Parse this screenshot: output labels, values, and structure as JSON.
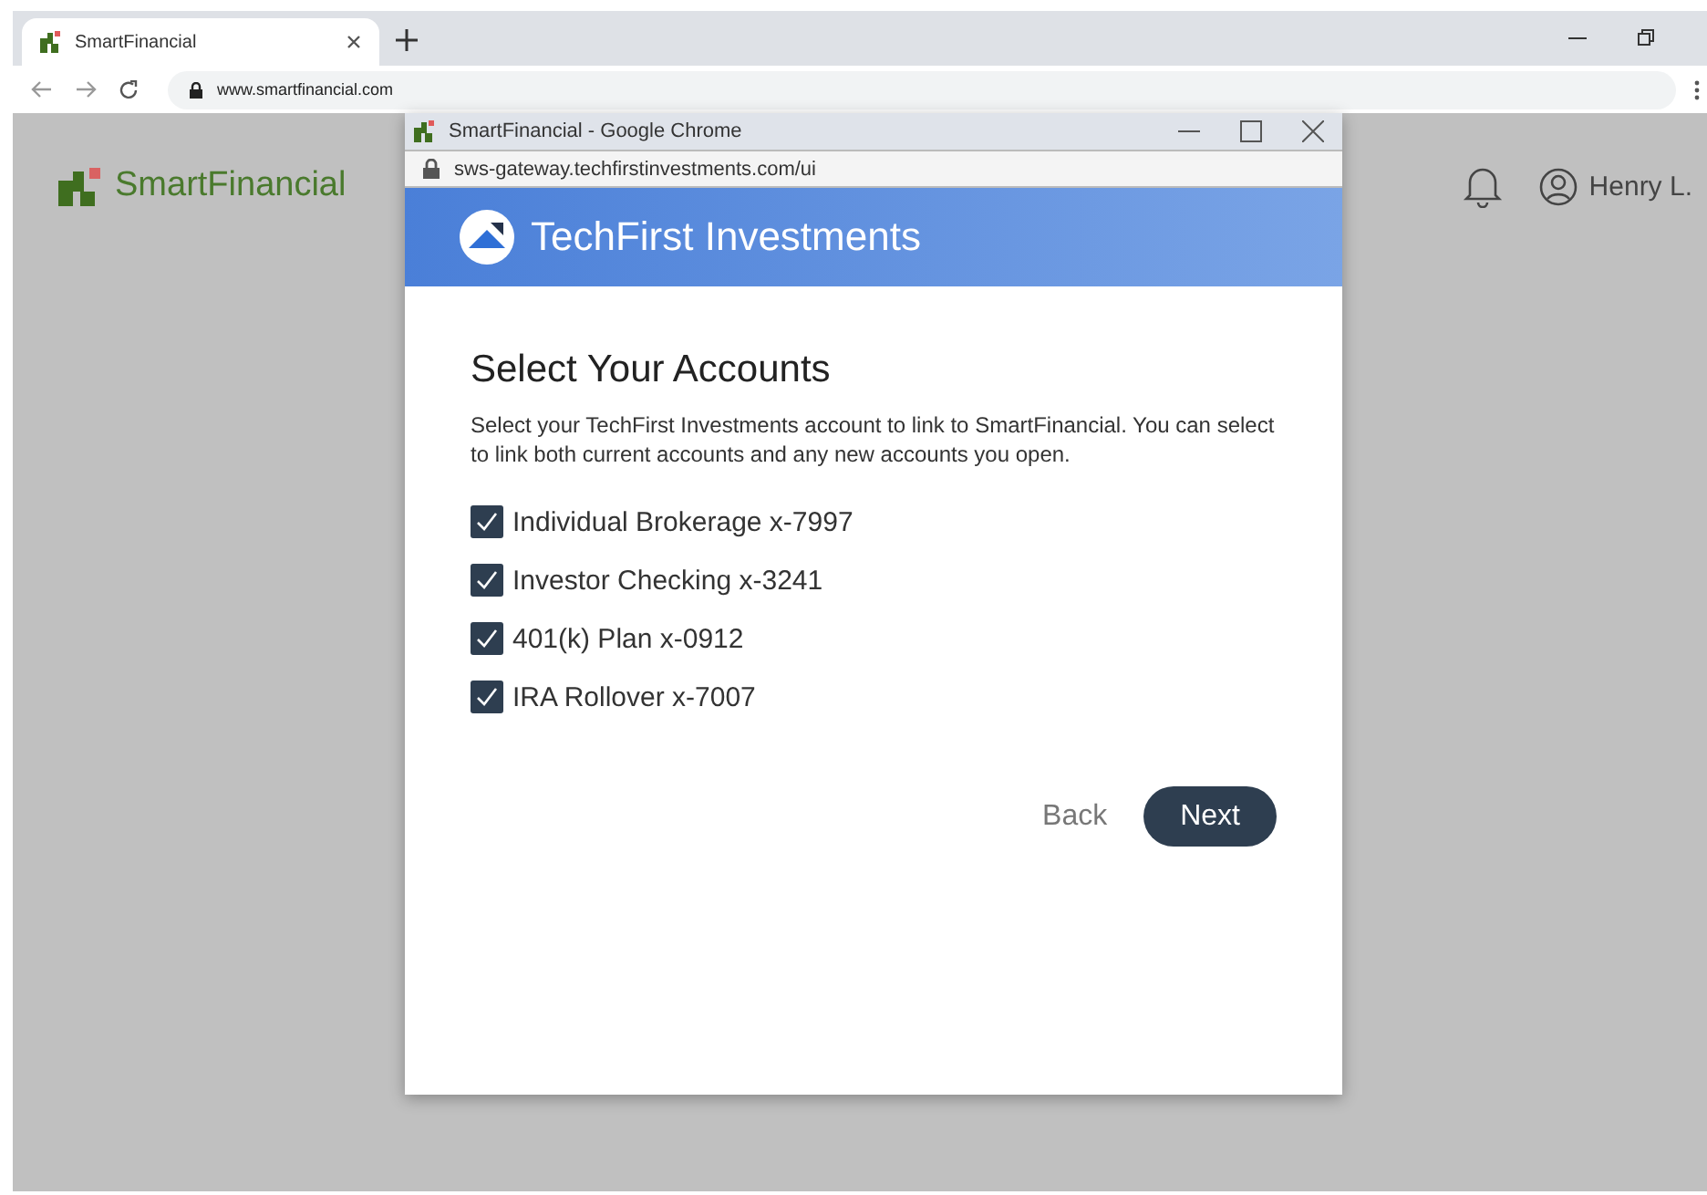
{
  "browser": {
    "tab": {
      "title": "SmartFinancial",
      "selected": true
    },
    "address": "www.smartfinancial.com"
  },
  "site": {
    "logo_text": "SmartFinancial",
    "user": "Henry L."
  },
  "popup": {
    "title": "SmartFinancial - Google Chrome",
    "address": "sws-gateway.techfirstinvestments.com/ui",
    "brand": "TechFirst Investments",
    "heading": "Select Your Accounts",
    "description": "Select your TechFirst Investments account to link to SmartFinancial. You can select to link both current accounts and any new accounts you open.",
    "accounts": [
      {
        "label": "Individual Brokerage x-7997",
        "checked": true
      },
      {
        "label": "Investor Checking x-3241",
        "checked": true
      },
      {
        "label": "401(k) Plan x-0912",
        "checked": true
      },
      {
        "label": "IRA Rollover x-7007",
        "checked": true
      }
    ],
    "buttons": [
      {
        "label": "Back",
        "kind": "text"
      },
      {
        "label": "Next",
        "kind": "primary"
      }
    ]
  }
}
